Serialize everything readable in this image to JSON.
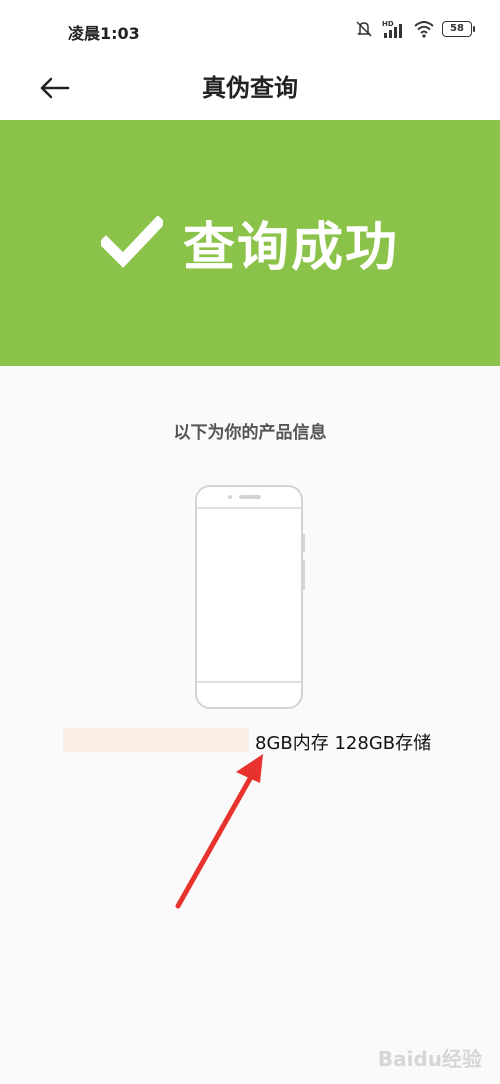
{
  "status_bar": {
    "time": "凌晨1:03",
    "battery": "58",
    "icons": [
      "mute-icon",
      "hd-signal-icon",
      "wifi-icon",
      "battery-icon"
    ]
  },
  "header": {
    "back_icon": "back-arrow-icon",
    "title": "真伪查询"
  },
  "banner": {
    "icon": "checkmark-icon",
    "text": "查询成功",
    "color": "#8bc34a"
  },
  "product": {
    "heading": "以下为你的产品信息",
    "image_icon": "phone-outline-icon",
    "spec": "8GB内存 128GB存储"
  },
  "annotation": {
    "color": "#e8322d"
  },
  "watermark": "Baidu经验"
}
